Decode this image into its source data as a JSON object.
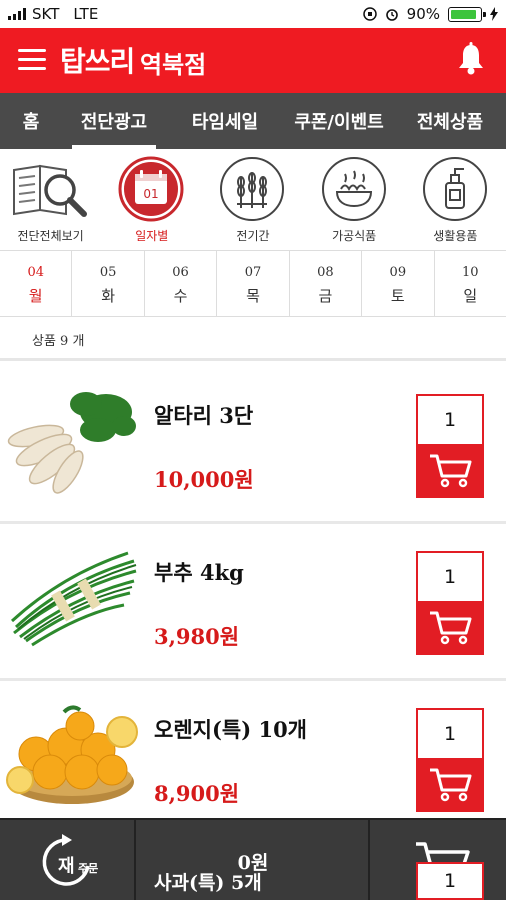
{
  "status_bar": {
    "carrier": "SKT",
    "network": "LTE",
    "battery": "90%",
    "battery_level": 0.9
  },
  "header": {
    "brand": "탑쓰리",
    "branch": "역북점",
    "menu_icon": "menu-icon",
    "bell_icon": "bell-icon",
    "accent": "#ef1b22"
  },
  "nav": {
    "items": [
      "홈",
      "전단광고",
      "타임세일",
      "쿠폰/이벤트",
      "전체상품"
    ],
    "active": "전단광고"
  },
  "categories": [
    {
      "label": "전단전체보기",
      "icon": "magnifier-book-icon"
    },
    {
      "label": "일자별",
      "icon": "calendar-icon",
      "active": true,
      "calendar_text": "01"
    },
    {
      "label": "전기간",
      "icon": "wheat-icon"
    },
    {
      "label": "가공식품",
      "icon": "noodle-bowl-icon"
    },
    {
      "label": "생활용품",
      "icon": "pump-bottle-icon"
    }
  ],
  "dates": [
    {
      "day": "04",
      "weekday": "월",
      "active": true
    },
    {
      "day": "05",
      "weekday": "화"
    },
    {
      "day": "06",
      "weekday": "수"
    },
    {
      "day": "07",
      "weekday": "목"
    },
    {
      "day": "08",
      "weekday": "금"
    },
    {
      "day": "09",
      "weekday": "토"
    },
    {
      "day": "10",
      "weekday": "일"
    }
  ],
  "product_count": "상품 9 개",
  "products": [
    {
      "name": "알타리 3단",
      "price": "10,000원",
      "qty": "1",
      "image": "radish-bunch"
    },
    {
      "name": "부추 4kg",
      "price": "3,980원",
      "qty": "1",
      "image": "chives-bundle"
    },
    {
      "name": "오렌지(특) 10개",
      "price": "8,900원",
      "qty": "1",
      "image": "orange-basket"
    }
  ],
  "peek_product": {
    "name": "사과(특) 5개",
    "qty": "1"
  },
  "bottom_bar": {
    "reorder_label_main": "재",
    "reorder_label_sub": "주문",
    "total": "0원"
  }
}
